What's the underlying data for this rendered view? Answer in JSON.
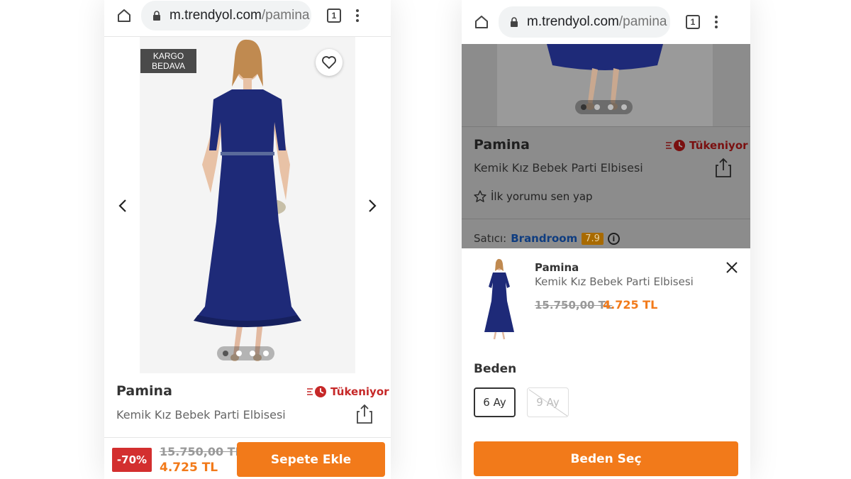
{
  "left": {
    "browser": {
      "url_host": "m.trendyol.com",
      "url_path": "/pamina",
      "tab_count": "1"
    },
    "badge": "KARGO BEDAVA",
    "carousel": {
      "dots": 4,
      "active": 0
    },
    "product": {
      "brand": "Pamina",
      "name": "Kemik Kız Bebek Parti Elbisesi",
      "stock_status": "Tükeniyor"
    },
    "bottom_bar": {
      "discount": "-70%",
      "old_price": "15.750,00 TL",
      "new_price": "4.725 TL",
      "cta": "Sepete Ekle"
    }
  },
  "right": {
    "browser": {
      "url_host": "m.trendyol.com",
      "url_path": "/pamina",
      "tab_count": "1"
    },
    "carousel": {
      "dots": 4,
      "active": 0
    },
    "product": {
      "brand": "Pamina",
      "name": "Kemik Kız Bebek Parti Elbisesi",
      "stock_status": "Tükeniyor"
    },
    "review_prompt": "İlk yorumu sen yap",
    "seller": {
      "label": "Satıcı:",
      "name": "Brandroom",
      "score": "7.9"
    },
    "sheet": {
      "brand": "Pamina",
      "name": "Kemik Kız Bebek Parti Elbisesi",
      "old_price": "15.750,00 TL",
      "new_price": "4.725 TL",
      "size_title": "Beden",
      "sizes": [
        {
          "label": "6 Ay",
          "state": "selected"
        },
        {
          "label": "9 Ay",
          "state": "unavailable"
        }
      ],
      "cta": "Beden Seç"
    }
  },
  "colors": {
    "accent_orange": "#f27a1a",
    "discount_red": "#d32f2f",
    "stock_red": "#c62828",
    "dress_navy": "#1e2a78"
  }
}
